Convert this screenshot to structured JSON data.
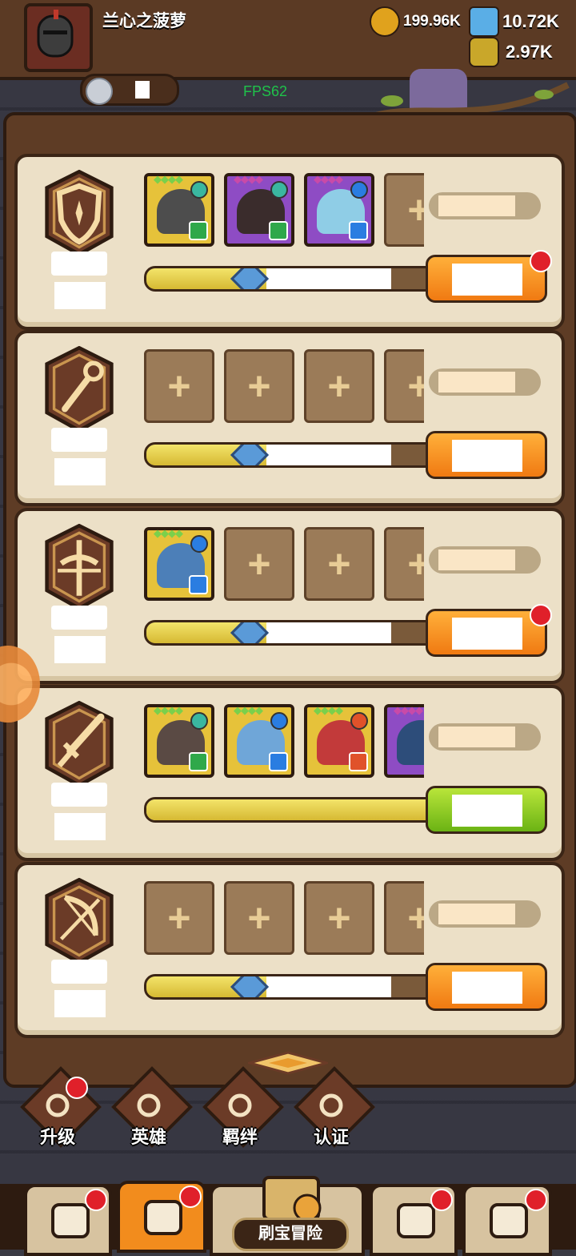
{
  "header": {
    "player_name": "兰心之菠萝",
    "resources": [
      {
        "name": "gold",
        "value": "199.96K",
        "icon": "gold-coin-icon",
        "color": "#e0a21d"
      },
      {
        "name": "crystal",
        "value": "10.72K",
        "icon": "blue-crystal-icon",
        "color": "#5aaee6"
      },
      {
        "name": "potion",
        "value": "2.97K",
        "icon": "potion-jar-icon",
        "color": "#c9a72a"
      }
    ],
    "fps": "FPS62"
  },
  "rows": [
    {
      "class_icon": "shield-icon",
      "has_dot": true,
      "button_color": "orange",
      "cards": [
        {
          "type": "hero",
          "frame": "#e6c23a",
          "face": "#4d4d4d",
          "stars": "◆◆◆◆",
          "star_color": "#7ad04b",
          "elem_color": "#3ab7a0",
          "role_color": "#2fa84a"
        },
        {
          "type": "hero",
          "frame": "#8e4cc4",
          "face": "#3a2c2c",
          "stars": "◆◆◆◆",
          "star_color": "#c84aa8",
          "elem_color": "#3ab7a0",
          "role_color": "#2fa84a"
        },
        {
          "type": "hero",
          "frame": "#8e4cc4",
          "face": "#8fcde6",
          "stars": "◆◆◆◆",
          "star_color": "#c84aa8",
          "elem_color": "#2a7de1",
          "role_color": "#2a7de1"
        },
        {
          "type": "empty"
        }
      ],
      "progress": 0.42
    },
    {
      "class_icon": "magic-staff-icon",
      "has_dot": false,
      "button_color": "orange",
      "cards": [
        {
          "type": "empty"
        },
        {
          "type": "empty"
        },
        {
          "type": "empty"
        },
        {
          "type": "empty"
        }
      ],
      "progress": 0.42
    },
    {
      "class_icon": "crossbow-icon",
      "has_dot": true,
      "button_color": "orange",
      "cards": [
        {
          "type": "hero",
          "frame": "#e6c23a",
          "face": "#4c7fb8",
          "stars": "◆◆◆◆",
          "star_color": "#7ad04b",
          "elem_color": "#2a7de1",
          "role_color": "#2a7de1"
        },
        {
          "type": "empty"
        },
        {
          "type": "empty"
        },
        {
          "type": "empty"
        }
      ],
      "progress": 0.42
    },
    {
      "class_icon": "sword-icon",
      "has_dot": false,
      "button_color": "green",
      "cards": [
        {
          "type": "hero",
          "frame": "#e6c23a",
          "face": "#5a4a44",
          "stars": "◆◆◆◆",
          "star_color": "#7ad04b",
          "elem_color": "#3ab7a0",
          "role_color": "#2fa84a"
        },
        {
          "type": "hero",
          "frame": "#e6c23a",
          "face": "#6fa6d8",
          "stars": "◆◆◆◆",
          "star_color": "#7ad04b",
          "elem_color": "#2a7de1",
          "role_color": "#2a7de1"
        },
        {
          "type": "hero",
          "frame": "#e6c23a",
          "face": "#c23a3a",
          "stars": "◆◆◆◆",
          "star_color": "#7ad04b",
          "elem_color": "#e0522a",
          "role_color": "#e0522a"
        },
        {
          "type": "hero",
          "frame": "#8e4cc4",
          "face": "#2d4d7a",
          "stars": "◆◆◆◆",
          "star_color": "#c84aa8",
          "elem_color": "#2a7de1",
          "role_color": "#2a7de1"
        }
      ],
      "progress": 1.0
    },
    {
      "class_icon": "bow-icon",
      "has_dot": false,
      "button_color": "orange",
      "cards": [
        {
          "type": "empty"
        },
        {
          "type": "empty"
        },
        {
          "type": "empty"
        },
        {
          "type": "empty"
        }
      ],
      "progress": 0.42
    }
  ],
  "sub_nav": [
    {
      "label": "升级",
      "icon": "upgrade-icon",
      "has_dot": true
    },
    {
      "label": "英雄",
      "icon": "hero-icon",
      "has_dot": false
    },
    {
      "label": "羁绊",
      "icon": "bond-fist-icon",
      "has_dot": false
    },
    {
      "label": "认证",
      "icon": "eye-certify-icon",
      "has_dot": false
    }
  ],
  "bottom_nav": [
    {
      "icon": "shop-icon",
      "has_dot": true,
      "active": false
    },
    {
      "icon": "hero-portrait-icon",
      "has_dot": true,
      "active": true
    },
    {
      "icon": "treasure-map-icon",
      "label": "刷宝冒险",
      "has_dot": false,
      "active": false
    },
    {
      "icon": "backpack-icon",
      "has_dot": true,
      "active": false
    },
    {
      "icon": "forge-hammer-icon",
      "has_dot": true,
      "active": false
    }
  ]
}
